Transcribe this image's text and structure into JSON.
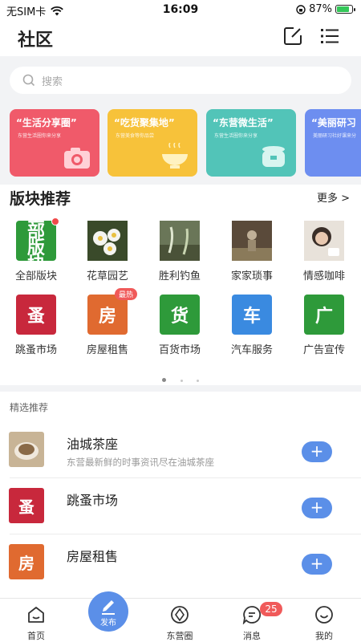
{
  "status_bar": {
    "carrier": "无SIM卡",
    "time": "16:09",
    "battery": "87%",
    "battery_level": 0.87
  },
  "header": {
    "title": "社区"
  },
  "search": {
    "placeholder": "搜索"
  },
  "banners": [
    {
      "title": "“生活分享圈”",
      "subtitle": "东营生活圈你来分享",
      "color": "#f05a6a",
      "icon": "camera-icon"
    },
    {
      "title": "“吃货聚集地”",
      "subtitle": "东营美食等你品尝",
      "color": "#f7c23a",
      "icon": "noodle-bowl-icon"
    },
    {
      "title": "“东营微生活”",
      "subtitle": "东营生活圈你来分享",
      "color": "#52c4b8",
      "icon": "rice-cooker-icon"
    },
    {
      "title": "“美丽研习",
      "subtitle": "美丽研习社好课来分",
      "color": "#6d8ef0",
      "icon": ""
    }
  ],
  "section": {
    "title": "版块推荐",
    "more": "更多 >"
  },
  "boards_row1": [
    {
      "label": "全部版块",
      "tile_text": "全部版块",
      "color": "#2e9a3a",
      "red_dot": true
    },
    {
      "label": "花草园艺",
      "tile_text": "",
      "color": "#4a5a3a"
    },
    {
      "label": "胜利钓鱼",
      "tile_text": "",
      "color": "#6a7a5a"
    },
    {
      "label": "家家琐事",
      "tile_text": "",
      "color": "#8a7a6a"
    },
    {
      "label": "情感咖啡",
      "tile_text": "",
      "color": "#d8d0c8"
    }
  ],
  "boards_row2": [
    {
      "label": "跳蚤市场",
      "tile_text": "蚤",
      "color": "#c8283c"
    },
    {
      "label": "房屋租售",
      "tile_text": "房",
      "color": "#e06a30",
      "badge": "最热"
    },
    {
      "label": "百货市场",
      "tile_text": "货",
      "color": "#2e9a3a"
    },
    {
      "label": "汽车服务",
      "tile_text": "车",
      "color": "#3a8ae0"
    },
    {
      "label": "广告宣传",
      "tile_text": "广",
      "color": "#2e9a3a"
    }
  ],
  "featured": {
    "title": "精选推荐",
    "items": [
      {
        "name": "油城茶座",
        "desc": "东营最新鲜的时事资讯尽在油城茶座",
        "thumb_text": "",
        "color": "#b89a78"
      },
      {
        "name": "跳蚤市场",
        "desc": "",
        "thumb_text": "蚤",
        "color": "#c8283c"
      },
      {
        "name": "房屋租售",
        "desc": "",
        "thumb_text": "房",
        "color": "#e06a30"
      }
    ],
    "add_label": "+"
  },
  "tabbar": {
    "home": "首页",
    "publish": "发布",
    "circle": "东营圈",
    "messages": "消息",
    "messages_badge": "25",
    "me": "我的"
  }
}
